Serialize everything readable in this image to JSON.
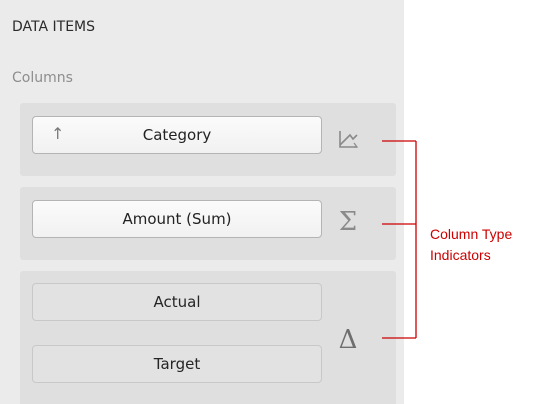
{
  "panel": {
    "section_title": "DATA ITEMS",
    "group_label": "Columns"
  },
  "columns": [
    {
      "label": "Category",
      "sort_indicator": "↑",
      "type_indicator": "dimension-sparkline-icon"
    },
    {
      "label": "Amount (Sum)",
      "type_indicator": "Σ",
      "type_indicator_name": "sigma-icon"
    },
    {
      "labels": [
        "Actual",
        "Target"
      ],
      "type_indicator": "Δ",
      "type_indicator_name": "delta-icon"
    }
  ],
  "annotation": {
    "line1": "Column Type",
    "line2": "Indicators",
    "color": "#cc0000"
  },
  "colors": {
    "panel_bg": "#ebebeb",
    "card_bg": "#dfdfdf",
    "accent_red": "#cc0000"
  }
}
